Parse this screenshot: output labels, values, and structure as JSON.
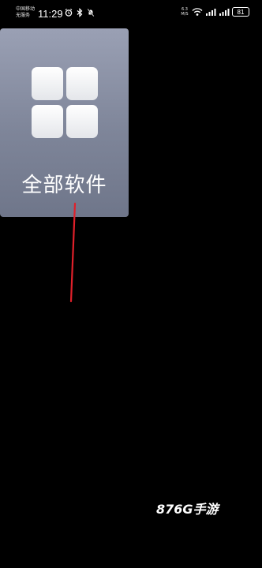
{
  "status_bar": {
    "carrier_line1": "中国移动",
    "carrier_line2": "无服务",
    "time": "11:29",
    "net_speed_value": "6.3",
    "net_speed_unit": "M/S",
    "battery": "81",
    "icons": [
      "alarm-icon",
      "bluetooth-icon",
      "mute-icon",
      "wifi-icon",
      "signal-icon",
      "signal-icon",
      "battery-icon"
    ]
  },
  "app_folder": {
    "label": "全部软件",
    "icon": "grid-icon"
  },
  "watermark": "876G手游",
  "colors": {
    "background": "#000000",
    "card_top": "#9aa0b4",
    "card_bottom": "#6f768a",
    "annotation_line": "#e0202a"
  }
}
